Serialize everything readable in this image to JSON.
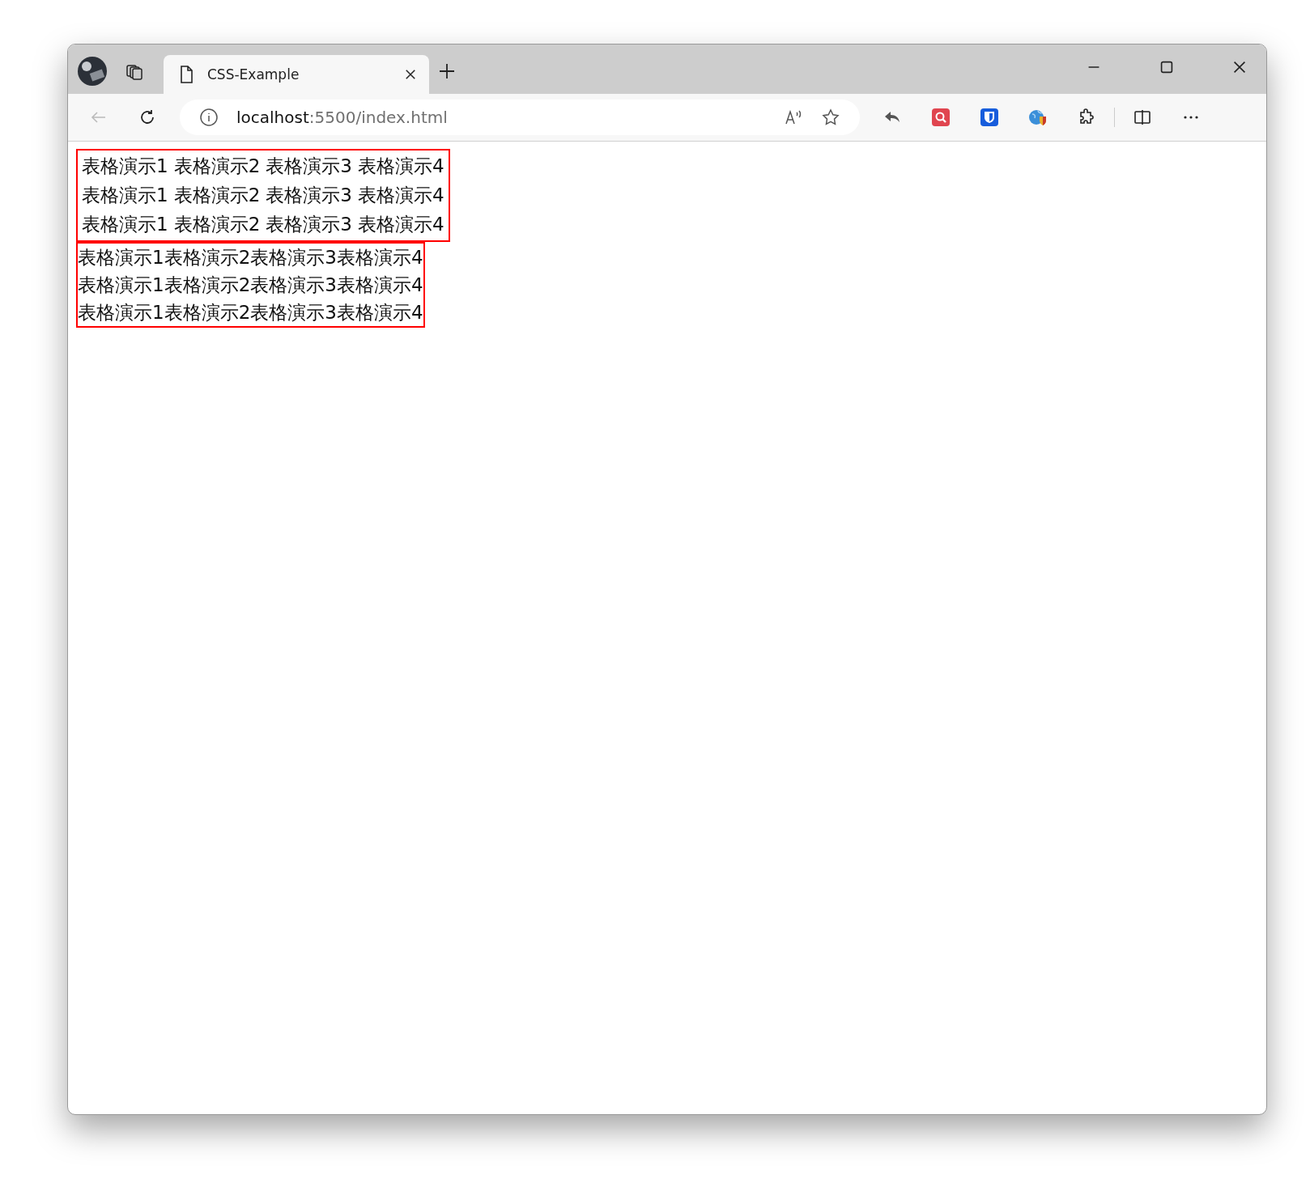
{
  "tab": {
    "title": "CSS-Example",
    "selected": true
  },
  "address": {
    "host": "localhost",
    "path": ":5500/index.html"
  },
  "tables": [
    {
      "kind": "spaced",
      "rows": [
        [
          "表格演示1",
          "表格演示2",
          "表格演示3",
          "表格演示4"
        ],
        [
          "表格演示1",
          "表格演示2",
          "表格演示3",
          "表格演示4"
        ],
        [
          "表格演示1",
          "表格演示2",
          "表格演示3",
          "表格演示4"
        ]
      ]
    },
    {
      "kind": "collapsed",
      "rows": [
        [
          "表格演示1",
          "表格演示2",
          "表格演示3",
          "表格演示4"
        ],
        [
          "表格演示1",
          "表格演示2",
          "表格演示3",
          "表格演示4"
        ],
        [
          "表格演示1",
          "表格演示2",
          "表格演示3",
          "表格演示4"
        ]
      ]
    }
  ]
}
